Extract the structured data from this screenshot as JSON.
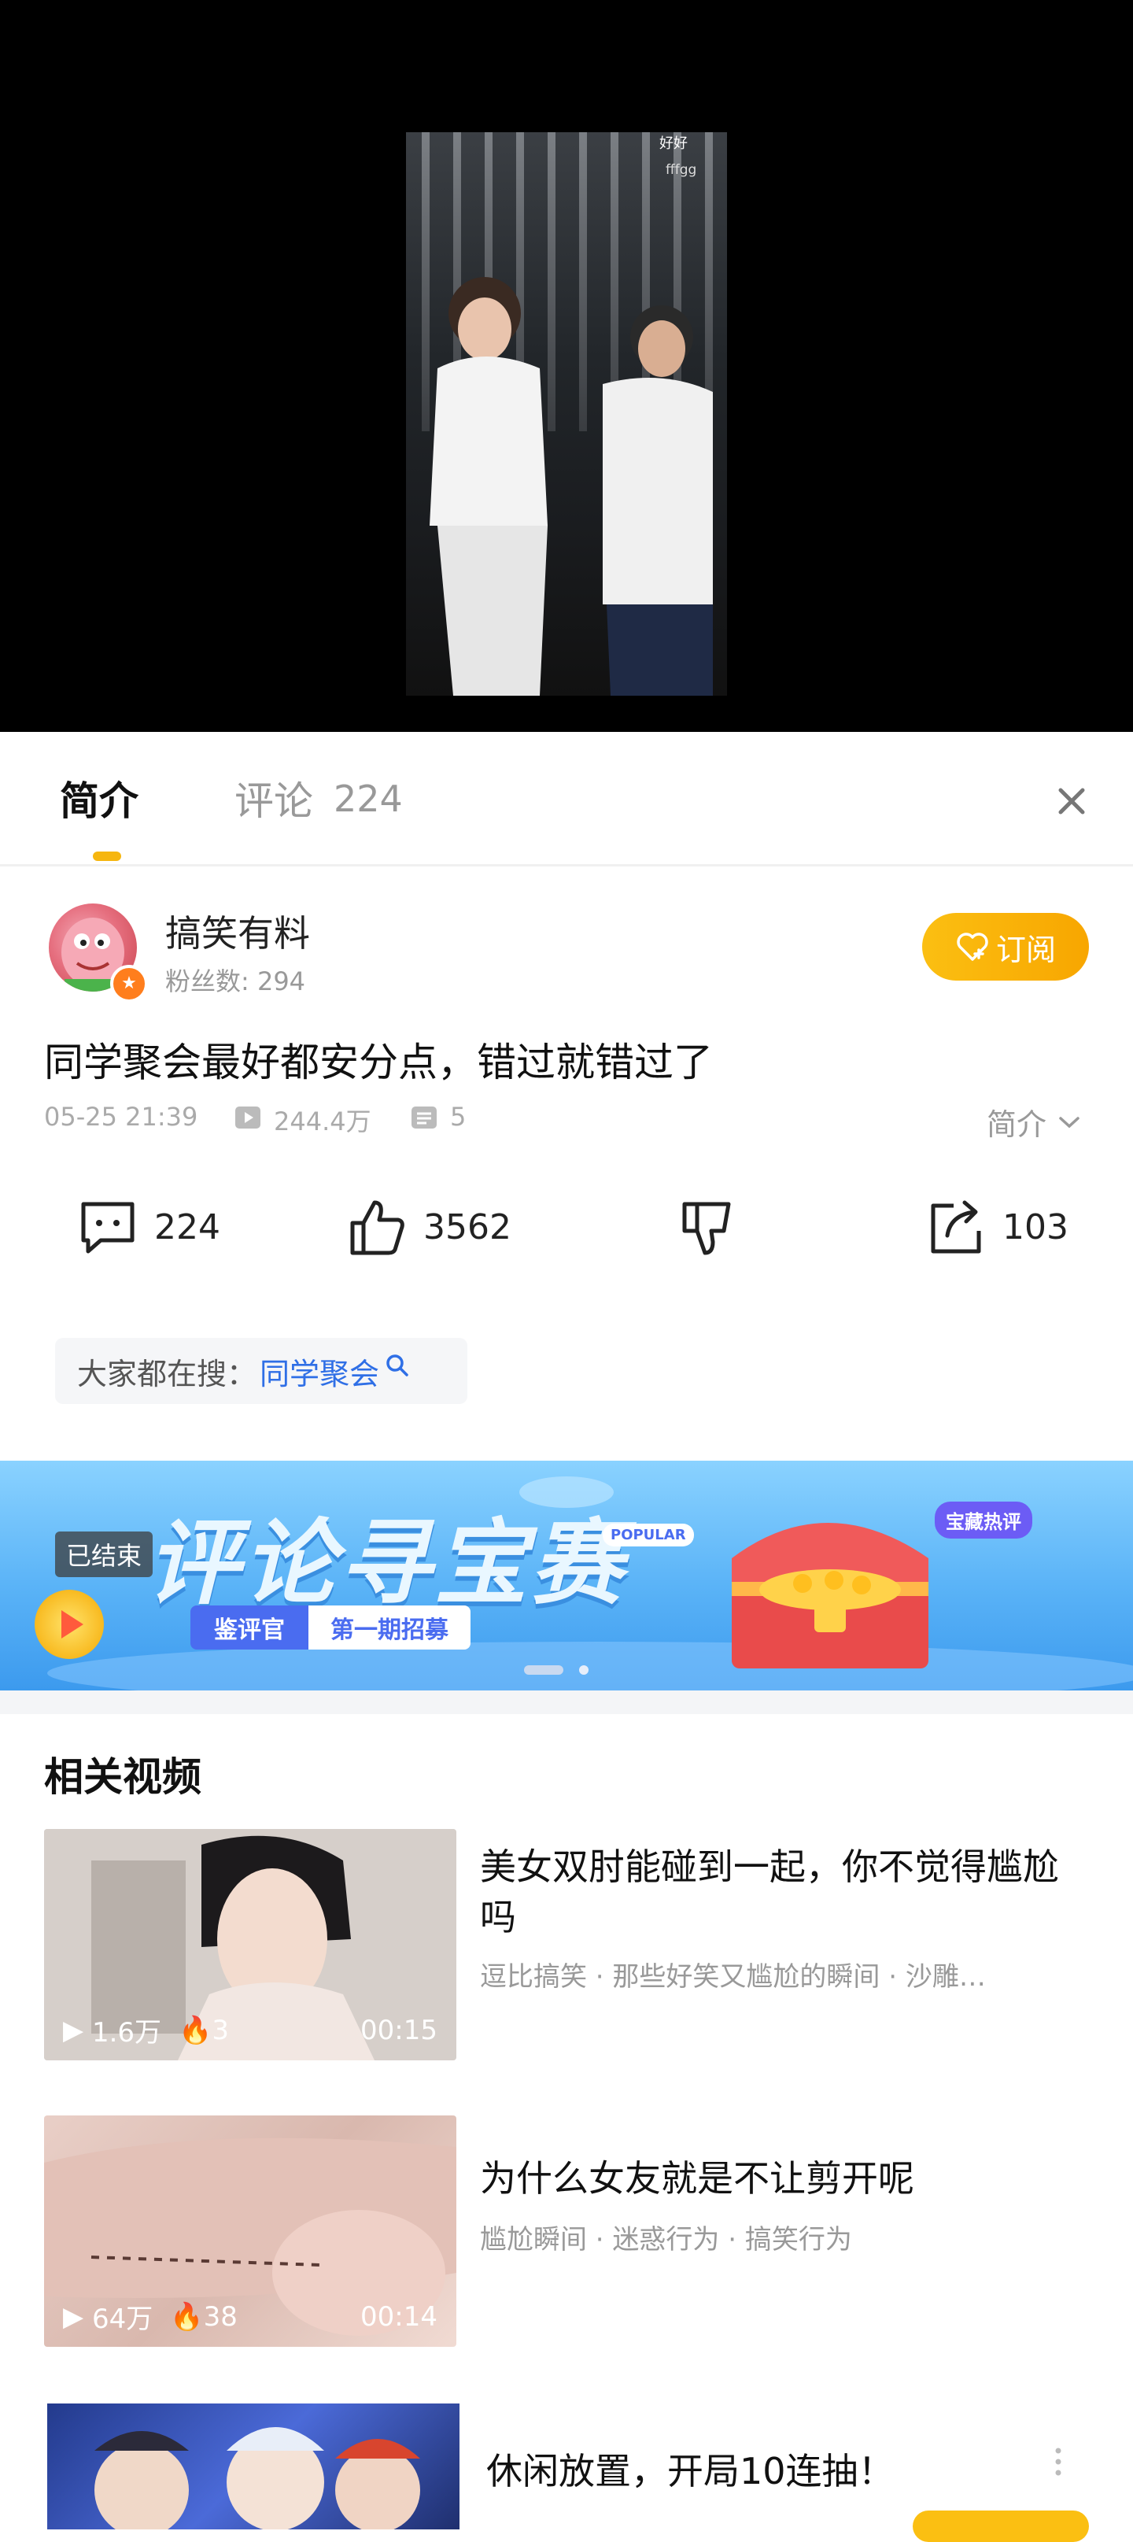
{
  "video": {
    "overlay_line1": "好好",
    "overlay_line2": "fffgg"
  },
  "tabs": {
    "intro": "简介",
    "comments_label": "评论",
    "comments_count": "224"
  },
  "author": {
    "name": "搞笑有料",
    "fans_label": "粉丝数: 294",
    "subscribe_label": "订阅"
  },
  "video_info": {
    "title": "同学聚会最好都安分点，错过就错过了",
    "date": "05-25 21:39",
    "views": "244.4万",
    "collections": "5",
    "intro_toggle": "简介"
  },
  "actions": {
    "comments": "224",
    "likes": "3562",
    "shares": "103"
  },
  "search": {
    "prefix": "大家都在搜：",
    "term": "同学聚会"
  },
  "banner": {
    "status": "已结束",
    "title": "评论寻宝赛",
    "tag1": "鉴评官",
    "tag2": "第一期招募",
    "popular": "POPULAR",
    "hot": "宝藏热评",
    "active_dot": 0
  },
  "related": {
    "title": "相关视频",
    "items": [
      {
        "title": "美女双肘能碰到一起，你不觉得尴尬吗",
        "tags": "逗比搞笑 · 那些好笑又尴尬的瞬间 · 沙雕…",
        "views": "1.6万",
        "hot": "3",
        "duration": "00:15"
      },
      {
        "title": "为什么女友就是不让剪开呢",
        "tags": "尴尬瞬间 · 迷惑行为 · 搞笑行为",
        "views": "64万",
        "hot": "38",
        "duration": "00:14"
      }
    ],
    "ad": {
      "title": "休闲放置，开局10连抽！"
    }
  },
  "colors": {
    "accent": "#f8a600",
    "link": "#2f6fe6",
    "muted": "#999999"
  }
}
